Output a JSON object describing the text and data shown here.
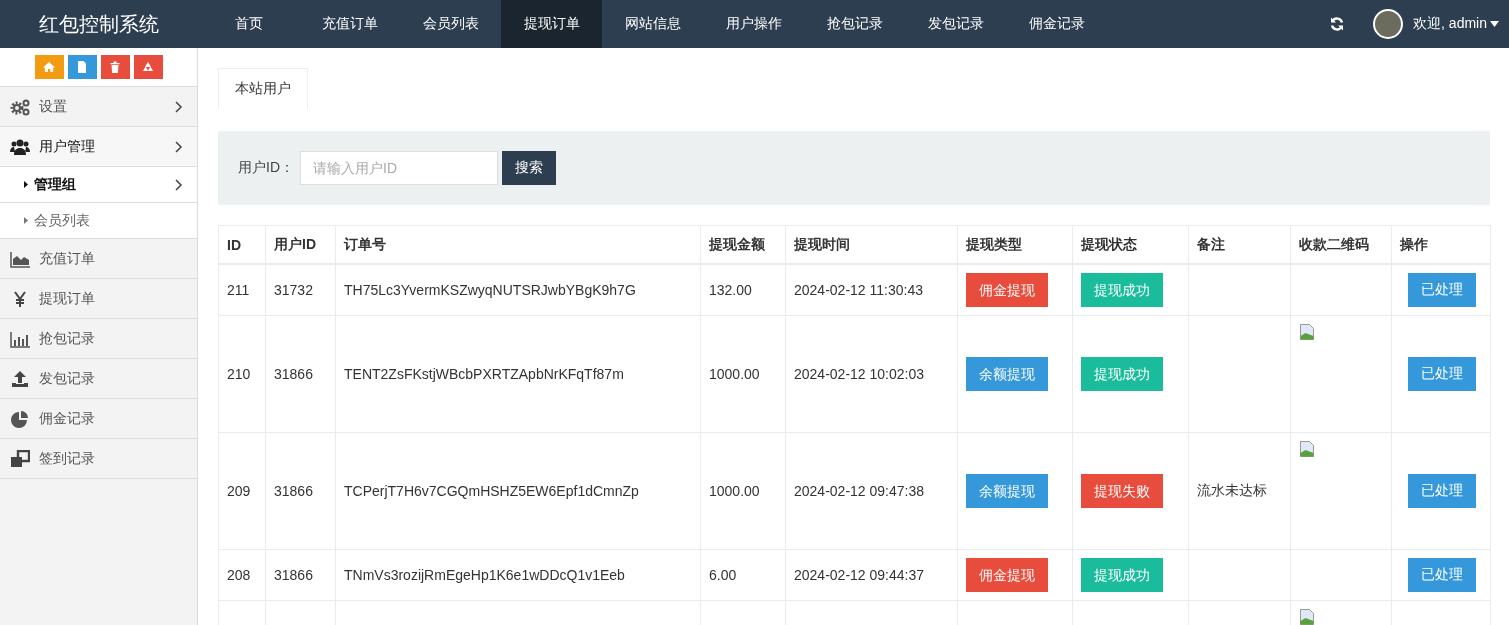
{
  "header": {
    "brand": "红包控制系统",
    "nav": [
      {
        "label": "首页",
        "selected": false
      },
      {
        "label": "充值订单",
        "selected": false
      },
      {
        "label": "会员列表",
        "selected": false
      },
      {
        "label": "提现订单",
        "selected": true
      },
      {
        "label": "网站信息",
        "selected": false
      },
      {
        "label": "用户操作",
        "selected": false
      },
      {
        "label": "抢包记录",
        "selected": false
      },
      {
        "label": "发包记录",
        "selected": false
      },
      {
        "label": "佣金记录",
        "selected": false
      }
    ],
    "user": {
      "greeting": "欢迎, admin"
    }
  },
  "sidebar": {
    "items": [
      {
        "label": "设置",
        "expandable": true,
        "expanded": false
      },
      {
        "label": "用户管理",
        "expandable": true,
        "expanded": true,
        "children": [
          {
            "label": "管理组",
            "expandable": true,
            "selected": true
          },
          {
            "label": "会员列表",
            "expandable": false,
            "selected": false
          }
        ]
      },
      {
        "label": "充值订单",
        "expandable": false,
        "expanded": false
      },
      {
        "label": "提现订单",
        "expandable": false,
        "expanded": false
      },
      {
        "label": "抢包记录",
        "expandable": false,
        "expanded": false
      },
      {
        "label": "发包记录",
        "expandable": false,
        "expanded": false
      },
      {
        "label": "佣金记录",
        "expandable": false,
        "expanded": false
      },
      {
        "label": "签到记录",
        "expandable": false,
        "expanded": false
      }
    ]
  },
  "tabs": [
    {
      "label": "本站用户",
      "selected": true
    }
  ],
  "search": {
    "label": "用户ID：",
    "placeholder": "请输入用户ID",
    "button": "搜索"
  },
  "table": {
    "columns": [
      "ID",
      "用户ID",
      "订单号",
      "提现金额",
      "提现时间",
      "提现类型",
      "提现状态",
      "备注",
      "收款二维码",
      "操作"
    ],
    "rows": [
      {
        "id": "211",
        "user_id": "31732",
        "order_no": "TH75Lc3YvermKSZwyqNUTSRJwbYBgK9h7G",
        "amount": "132.00",
        "time": "2024-02-12 11:30:43",
        "type": {
          "label": "佣金提现",
          "color": "#e74c3c"
        },
        "status": {
          "label": "提现成功",
          "color": "#1abc9c"
        },
        "qr_image": false,
        "action": "已处理"
      },
      {
        "id": "210",
        "user_id": "31866",
        "order_no": "TENT2ZsFKstjWBcbPXRTZApbNrKFqTf87m",
        "amount": "1000.00",
        "time": "2024-02-12 10:02:03",
        "type": {
          "label": "余额提现",
          "color": "#3498db"
        },
        "status": {
          "label": "提现成功",
          "color": "#1abc9c"
        },
        "qr_image": true,
        "action": "已处理"
      },
      {
        "id": "209",
        "user_id": "31866",
        "order_no": "TCPerjT7H6v7CGQmHSHZ5EW6Epf1dCmnZp",
        "amount": "1000.00",
        "time": "2024-02-12 09:47:38",
        "type": {
          "label": "余额提现",
          "color": "#3498db"
        },
        "status": {
          "label": "提现失败",
          "color": "#e74c3c"
        },
        "note": "流水未达标",
        "qr_image": true,
        "action": "已处理"
      },
      {
        "id": "208",
        "user_id": "31866",
        "order_no": "TNmVs3rozijRmEgeHp1K6e1wDDcQ1v1Eeb",
        "amount": "6.00",
        "time": "2024-02-12 09:44:37",
        "type": {
          "label": "佣金提现",
          "color": "#e74c3c"
        },
        "status": {
          "label": "提现成功",
          "color": "#1abc9c"
        },
        "qr_image": false,
        "action": "已处理"
      },
      {
        "qr_image": true
      }
    ]
  }
}
